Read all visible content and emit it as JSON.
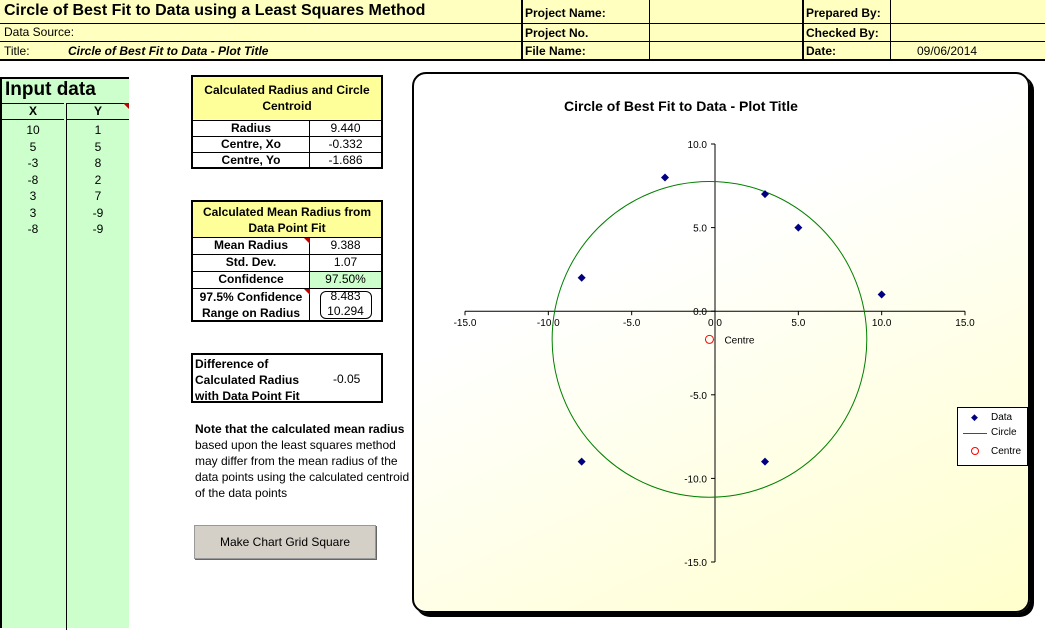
{
  "header": {
    "main_title": "Circle of Best Fit to Data using a Least Squares Method",
    "data_source_label": "Data Source:",
    "title_label": "Title:",
    "title_value": "Circle of Best Fit to Data - Plot Title",
    "project_name_label": "Project Name:",
    "project_no_label": "Project No.",
    "file_name_label": "File Name:",
    "prepared_by_label": "Prepared By:",
    "checked_by_label": "Checked By:",
    "date_label": "Date:",
    "date_value": "09/06/2014"
  },
  "input": {
    "title": "Input data",
    "col_x": "X",
    "col_y": "Y",
    "rows": [
      {
        "x": "10",
        "y": "1"
      },
      {
        "x": "5",
        "y": "5"
      },
      {
        "x": "-3",
        "y": "8"
      },
      {
        "x": "-8",
        "y": "2"
      },
      {
        "x": "3",
        "y": "7"
      },
      {
        "x": "3",
        "y": "-9"
      },
      {
        "x": "-8",
        "y": "-9"
      }
    ]
  },
  "radius_table": {
    "title": "Calculated Radius and Circle Centroid",
    "rows": [
      {
        "label": "Radius",
        "value": "9.440"
      },
      {
        "label": "Centre, Xo",
        "value": "-0.332"
      },
      {
        "label": "Centre, Yo",
        "value": "-1.686"
      }
    ]
  },
  "mean_table": {
    "title": "Calculated Mean Radius from Data Point Fit",
    "mean_label": "Mean Radius",
    "mean_value": "9.388",
    "std_label": "Std. Dev.",
    "std_value": "1.07",
    "conf_label": "Confidence",
    "conf_value": "97.50%",
    "range_label_1": "97.5% Confidence",
    "range_label_2": "Range on Radius",
    "range_low": "8.483",
    "range_high": "10.294"
  },
  "difference": {
    "label_1": "Difference of",
    "label_2": "Calculated Radius",
    "label_3": "with Data Point Fit",
    "value": "-0.05"
  },
  "note": {
    "bold": "Note that the calculated mean radius",
    "text": "based upon the least squares method may differ from the mean radius of the data points using the calculated centroid of the data points"
  },
  "button": {
    "label": "Make Chart Grid Square"
  },
  "colors": {
    "header_bg": "#ffffc0",
    "input_bg": "#ccffcc",
    "table_title_bg": "#ffff99",
    "confidence_bg": "#ccffcc",
    "data_marker": "#000080",
    "circle_line": "#008000",
    "centre_marker": "#ff0000"
  },
  "chart_data": {
    "type": "scatter",
    "title": "Circle of Best Fit to Data - Plot Title",
    "xlim": [
      -15,
      15
    ],
    "ylim": [
      -15,
      10
    ],
    "x_ticks": [
      "-15.0",
      "-10.0",
      "-5.0",
      "0.0",
      "5.0",
      "10.0",
      "15.0"
    ],
    "y_ticks": [
      "10.0",
      "5.0",
      "0.0",
      "-5.0",
      "-10.0",
      "-15.0"
    ],
    "legend_position": "right",
    "series": [
      {
        "name": "Data",
        "points": [
          [
            10,
            1
          ],
          [
            5,
            5
          ],
          [
            -3,
            8
          ],
          [
            -8,
            2
          ],
          [
            3,
            7
          ],
          [
            3,
            -9
          ],
          [
            -8,
            -9
          ]
        ]
      },
      {
        "name": "Circle",
        "centre": [
          -0.332,
          -1.686
        ],
        "radius": 9.44
      },
      {
        "name": "Centre",
        "points": [
          [
            -0.332,
            -1.686
          ]
        ]
      }
    ],
    "annotations": [
      {
        "text": "Centre"
      }
    ]
  }
}
